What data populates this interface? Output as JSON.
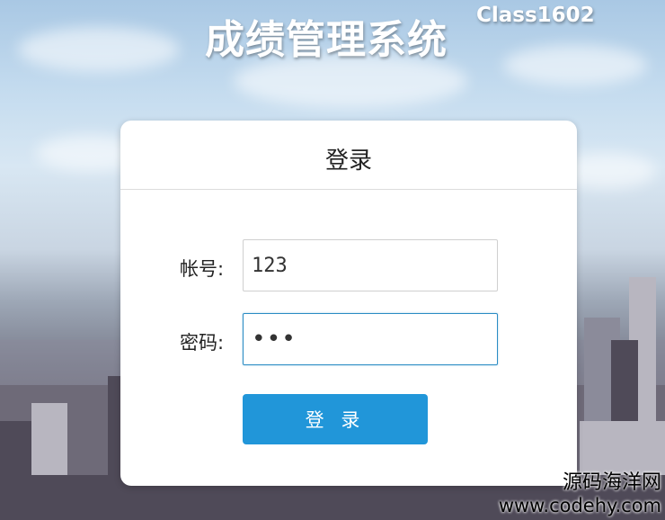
{
  "app": {
    "title": "成绩管理系统",
    "class_label": "Class1602"
  },
  "login_card": {
    "heading": "登录",
    "username": {
      "label": "帐号:",
      "value": "123"
    },
    "password": {
      "label": "密码:",
      "value": "123"
    },
    "submit_label": "登 录"
  },
  "watermark": {
    "line1": "源码海洋网",
    "line2": "www.codehy.com"
  },
  "colors": {
    "button": "#2196d9",
    "focus_border": "#2b8cc4"
  }
}
